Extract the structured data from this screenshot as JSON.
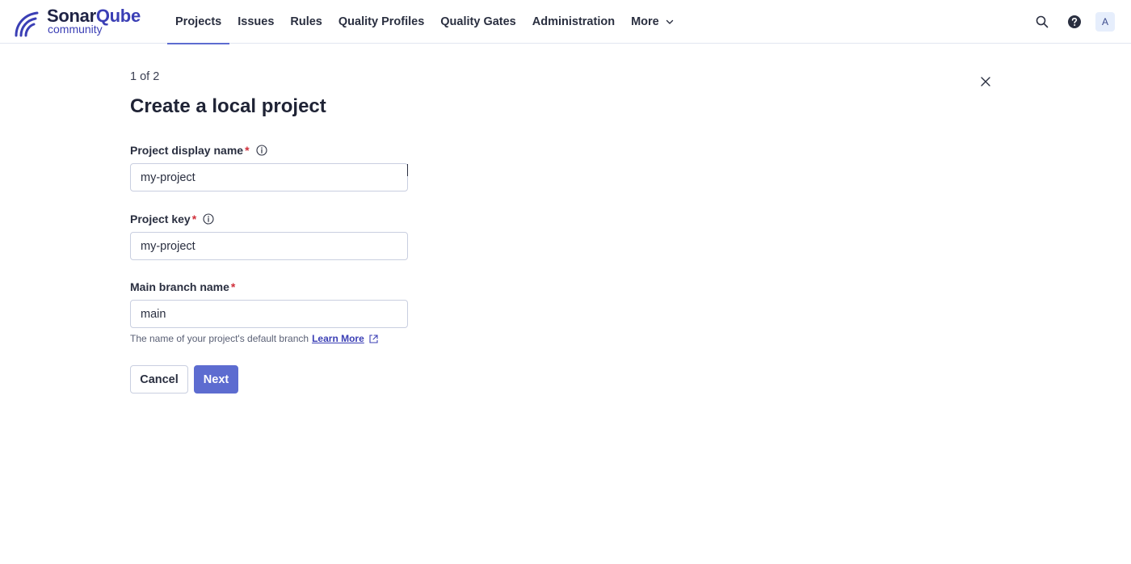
{
  "app": {
    "brand_part1": "Sonar",
    "brand_part2": "Qube",
    "edition": "community"
  },
  "nav": {
    "items": [
      {
        "label": "Projects",
        "active": true
      },
      {
        "label": "Issues"
      },
      {
        "label": "Rules"
      },
      {
        "label": "Quality Profiles"
      },
      {
        "label": "Quality Gates"
      },
      {
        "label": "Administration"
      },
      {
        "label": "More"
      }
    ]
  },
  "header": {
    "avatar_initial": "A",
    "icons": [
      "search-icon",
      "help-icon"
    ]
  },
  "form": {
    "step": "1 of 2",
    "title": "Create a local project",
    "display_name": {
      "label": "Project display name",
      "required_mark": "*",
      "value": "my-project"
    },
    "project_key": {
      "label": "Project key",
      "required_mark": "*",
      "value": "my-project"
    },
    "main_branch": {
      "label": "Main branch name",
      "required_mark": "*",
      "value": "main"
    },
    "help_text": "The name of your project's default branch",
    "help_link": "Learn More",
    "cancel_label": "Cancel",
    "next_label": "Next"
  },
  "colors": {
    "accent": "#5d6cd0",
    "brand": "#3b3fb5",
    "required": "#d02f3a"
  }
}
